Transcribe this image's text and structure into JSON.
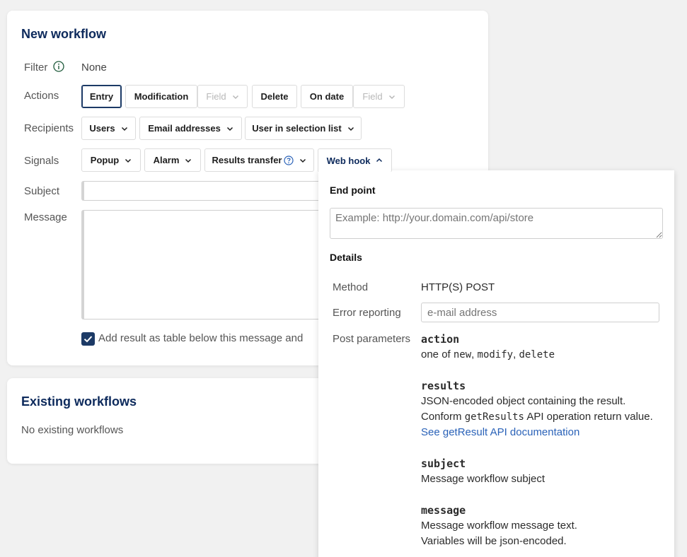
{
  "new_workflow": {
    "title": "New workflow",
    "filter": {
      "label": "Filter",
      "value": "None",
      "icon": "info-icon"
    },
    "actions": {
      "label": "Actions",
      "buttons": [
        "Entry",
        "Modification",
        "Field",
        "Delete",
        "On date",
        "Field"
      ]
    },
    "recipients": {
      "label": "Recipients",
      "buttons": [
        "Users",
        "Email addresses",
        "User in selection list"
      ]
    },
    "signals": {
      "label": "Signals",
      "buttons": [
        "Popup",
        "Alarm",
        "Results transfer",
        "Web hook"
      ]
    },
    "subject": {
      "label": "Subject",
      "value": ""
    },
    "message": {
      "label": "Message",
      "value": ""
    },
    "add_result": {
      "checked": true,
      "text": "Add result as table below this message and"
    }
  },
  "existing_workflows": {
    "title": "Existing workflows",
    "empty_text": "No existing workflows"
  },
  "webhook_popup": {
    "endpoint_heading": "End point",
    "endpoint_placeholder": "Example: http://your.domain.com/api/store",
    "details_heading": "Details",
    "method_label": "Method",
    "method_value": "HTTP(S) POST",
    "error_label": "Error reporting",
    "error_placeholder": "e-mail address",
    "post_label": "Post parameters",
    "params": {
      "action_name": "action",
      "action_prefix": "one of ",
      "action_v1": "new",
      "action_sep1": ", ",
      "action_v2": "modify",
      "action_sep2": ", ",
      "action_v3": "delete",
      "results_name": "results",
      "results_line1": "JSON-encoded object containing the result.",
      "results_line2_pre": "Conform ",
      "results_line2_code": "getResults",
      "results_line2_post": " API operation return value.",
      "results_link": "See getResult API documentation",
      "subject_name": "subject",
      "subject_desc": "Message workflow subject",
      "message_name": "message",
      "message_line1": "Message workflow message text.",
      "message_line2": "Variables will be json-encoded."
    }
  },
  "colors": {
    "title": "#0d2a5c",
    "active_border": "#1c3a66",
    "link": "#2a62b8",
    "checkbox": "#1c3a66"
  }
}
